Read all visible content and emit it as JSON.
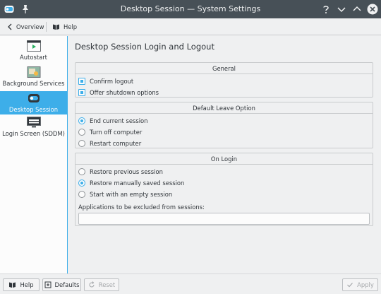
{
  "window": {
    "title": "Desktop Session  — System Settings"
  },
  "toolbar": {
    "overview_label": "Overview",
    "help_label": "Help"
  },
  "sidebar": {
    "items": [
      {
        "label": "Autostart",
        "icon": "autostart-icon",
        "active": false
      },
      {
        "label": "Background Services",
        "icon": "background-services-icon",
        "active": false
      },
      {
        "label": "Desktop Session",
        "icon": "desktop-session-icon",
        "active": true
      },
      {
        "label": "Login Screen (SDDM)",
        "icon": "login-screen-icon",
        "active": false
      }
    ]
  },
  "main": {
    "title": "Desktop Session Login and Logout",
    "general": {
      "title": "General",
      "confirm_logout": {
        "label": "Confirm logout",
        "checked": true
      },
      "shutdown_options": {
        "label": "Offer shutdown options",
        "checked": true
      }
    },
    "leave": {
      "title": "Default Leave Option",
      "options": [
        {
          "label": "End current session",
          "selected": true
        },
        {
          "label": "Turn off computer",
          "selected": false
        },
        {
          "label": "Restart computer",
          "selected": false
        }
      ]
    },
    "login": {
      "title": "On Login",
      "options": [
        {
          "label": "Restore previous session",
          "selected": false
        },
        {
          "label": "Restore manually saved session",
          "selected": true
        },
        {
          "label": "Start with an empty session",
          "selected": false
        }
      ],
      "exclude_label": "Applications to be excluded from sessions:",
      "exclude_value": ""
    }
  },
  "bottom": {
    "help_label": "Help",
    "defaults_label": "Defaults",
    "reset_label": "Reset",
    "apply_label": "Apply"
  },
  "colors": {
    "accent": "#3daee9",
    "titlebar": "#475057",
    "window": "#eff0f1"
  }
}
